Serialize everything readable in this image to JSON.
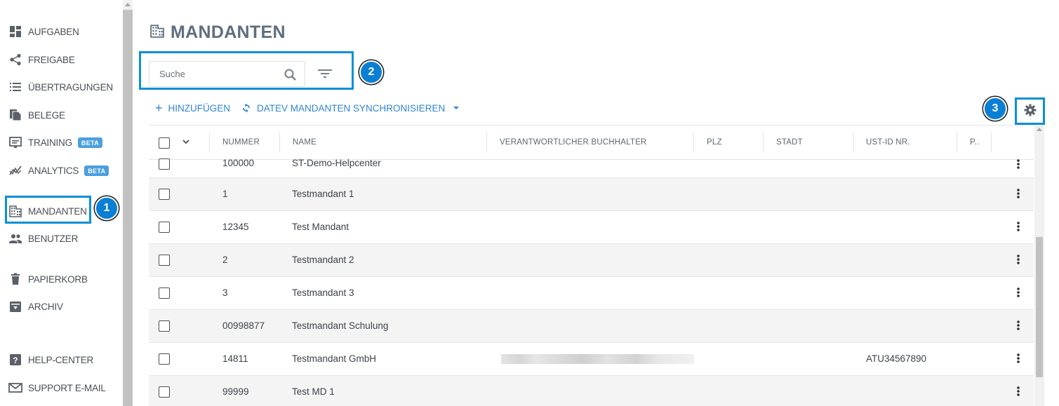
{
  "sidebar": {
    "items": [
      {
        "label": "AUFGABEN",
        "icon": "dashboard-icon"
      },
      {
        "label": "FREIGABE",
        "icon": "share-icon"
      },
      {
        "label": "ÜBERTRAGUNGEN",
        "icon": "list-icon"
      },
      {
        "label": "BELEGE",
        "icon": "documents-icon"
      },
      {
        "label": "TRAINING",
        "icon": "training-icon",
        "badge": "BETA"
      },
      {
        "label": "ANALYTICS",
        "icon": "analytics-icon",
        "badge": "BETA"
      },
      {
        "label": "MANDANTEN",
        "icon": "building-icon"
      },
      {
        "label": "BENUTZER",
        "icon": "users-icon"
      },
      {
        "label": "PAPIERKORB",
        "icon": "trash-icon"
      },
      {
        "label": "ARCHIV",
        "icon": "archive-icon"
      },
      {
        "label": "HELP-CENTER",
        "icon": "help-icon"
      },
      {
        "label": "SUPPORT E-MAIL",
        "icon": "mail-icon"
      }
    ]
  },
  "steps": [
    "1",
    "2",
    "3"
  ],
  "main": {
    "title": "MANDANTEN",
    "search": {
      "placeholder": "Suche"
    },
    "actions": {
      "add": "HINZUFÜGEN",
      "sync": "DATEV MANDANTEN SYNCHRONISIEREN"
    },
    "table": {
      "columns": [
        "NUMMER",
        "NAME",
        "VERANTWORTLICHER BUCHHALTER",
        "PLZ",
        "STADT",
        "UST-ID NR.",
        "P.."
      ],
      "rows": [
        {
          "nummer": "100000",
          "name": "ST-Demo-Helpcenter",
          "ust": ""
        },
        {
          "nummer": "1",
          "name": "Testmandant 1",
          "ust": ""
        },
        {
          "nummer": "12345",
          "name": "Test Mandant",
          "ust": ""
        },
        {
          "nummer": "2",
          "name": "Testmandant 2",
          "ust": ""
        },
        {
          "nummer": "3",
          "name": "Testmandant 3",
          "ust": ""
        },
        {
          "nummer": "00998877",
          "name": "Testmandant Schulung",
          "ust": ""
        },
        {
          "nummer": "14811",
          "name": "Testmandant GmbH",
          "ust": "ATU34567890"
        },
        {
          "nummer": "99999",
          "name": "Test MD 1",
          "ust": ""
        }
      ]
    }
  },
  "colors": {
    "accent": "#2f86d0",
    "highlight": "#0a8fd6",
    "step": "#0a7fd4"
  }
}
